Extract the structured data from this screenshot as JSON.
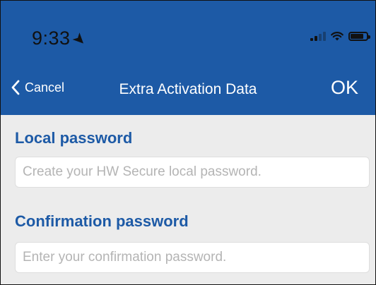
{
  "status_bar": {
    "time": "9:33",
    "location_icon": "location-arrow-icon",
    "signal_icon": "cellular-signal-icon",
    "wifi_icon": "wifi-icon",
    "battery_icon": "battery-icon"
  },
  "nav": {
    "back_icon": "chevron-left-icon",
    "cancel_label": "Cancel",
    "title": "Extra Activation Data",
    "ok_label": "OK"
  },
  "form": {
    "local_password": {
      "label": "Local password",
      "placeholder": "Create your HW Secure local password.",
      "value": ""
    },
    "confirmation_password": {
      "label": "Confirmation password",
      "placeholder": "Enter your confirmation password.",
      "value": ""
    }
  },
  "colors": {
    "header_bg": "#1d5aa6",
    "label_text": "#1d5aa6",
    "content_bg": "#ececec",
    "placeholder_text": "#b4b4b4"
  }
}
